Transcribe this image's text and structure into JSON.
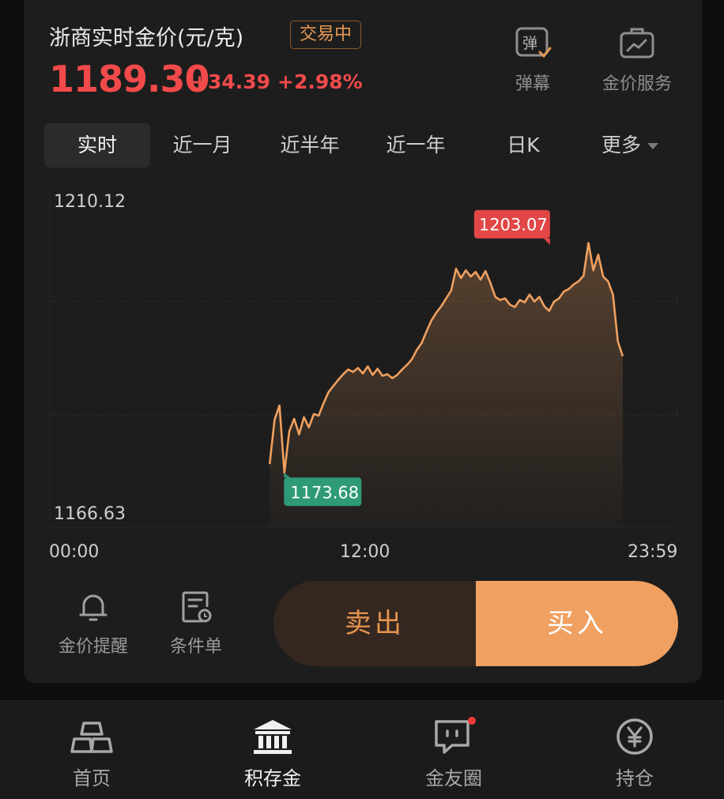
{
  "header": {
    "title": "浙商实时金价(元/克)",
    "status_badge": "交易中",
    "price": "1189.30",
    "change_abs": "+34.39",
    "change_pct": "+2.98%",
    "price_color": "#f24a4a",
    "actions": [
      {
        "label": "弹幕",
        "icon": "danmaku-icon"
      },
      {
        "label": "金价服务",
        "icon": "briefcase-chart-icon"
      }
    ]
  },
  "tabs": [
    {
      "label": "实时",
      "active": true
    },
    {
      "label": "近一月",
      "active": false
    },
    {
      "label": "近半年",
      "active": false
    },
    {
      "label": "近一年",
      "active": false
    },
    {
      "label": "日K",
      "active": false
    },
    {
      "label": "更多",
      "active": false
    }
  ],
  "chart_data": {
    "type": "area",
    "y_axis": {
      "max_label": "1210.12",
      "min_label": "1166.63",
      "ylim": [
        1166.63,
        1210.12
      ]
    },
    "x_axis": {
      "labels": [
        "00:00",
        "12:00",
        "23:59"
      ],
      "xlim": [
        0,
        1439
      ]
    },
    "grid": true,
    "line_color": "#f0a060",
    "high": {
      "label": "1203.07",
      "value": 1203.07,
      "time": 1226
    },
    "low": {
      "label": "1173.68",
      "value": 1173.68,
      "time": 575
    },
    "points": [
      [
        540,
        1174.8
      ],
      [
        552,
        1180.5
      ],
      [
        564,
        1182.3
      ],
      [
        576,
        1173.7
      ],
      [
        588,
        1179.0
      ],
      [
        600,
        1180.6
      ],
      [
        612,
        1178.6
      ],
      [
        624,
        1180.8
      ],
      [
        636,
        1179.5
      ],
      [
        648,
        1181.2
      ],
      [
        660,
        1181.0
      ],
      [
        672,
        1182.6
      ],
      [
        684,
        1184.0
      ],
      [
        696,
        1184.8
      ],
      [
        708,
        1185.6
      ],
      [
        720,
        1186.3
      ],
      [
        732,
        1186.9
      ],
      [
        744,
        1186.6
      ],
      [
        756,
        1187.1
      ],
      [
        768,
        1186.4
      ],
      [
        780,
        1187.3
      ],
      [
        792,
        1186.2
      ],
      [
        804,
        1187.0
      ],
      [
        816,
        1186.1
      ],
      [
        828,
        1186.3
      ],
      [
        840,
        1185.8
      ],
      [
        852,
        1186.2
      ],
      [
        864,
        1186.9
      ],
      [
        876,
        1187.5
      ],
      [
        888,
        1188.2
      ],
      [
        900,
        1189.4
      ],
      [
        912,
        1190.3
      ],
      [
        924,
        1191.8
      ],
      [
        936,
        1193.2
      ],
      [
        948,
        1194.2
      ],
      [
        960,
        1195.0
      ],
      [
        972,
        1196.0
      ],
      [
        984,
        1197.0
      ],
      [
        996,
        1199.8
      ],
      [
        1008,
        1198.6
      ],
      [
        1020,
        1199.6
      ],
      [
        1032,
        1198.8
      ],
      [
        1044,
        1199.4
      ],
      [
        1056,
        1198.4
      ],
      [
        1068,
        1199.5
      ],
      [
        1080,
        1198.0
      ],
      [
        1092,
        1196.2
      ],
      [
        1104,
        1195.8
      ],
      [
        1116,
        1196.0
      ],
      [
        1128,
        1195.2
      ],
      [
        1140,
        1194.9
      ],
      [
        1152,
        1195.8
      ],
      [
        1164,
        1195.5
      ],
      [
        1176,
        1196.5
      ],
      [
        1188,
        1195.6
      ],
      [
        1200,
        1196.2
      ],
      [
        1212,
        1195.0
      ],
      [
        1224,
        1194.4
      ],
      [
        1236,
        1195.6
      ],
      [
        1248,
        1196.0
      ],
      [
        1260,
        1196.9
      ],
      [
        1272,
        1197.2
      ],
      [
        1284,
        1197.8
      ],
      [
        1296,
        1198.2
      ],
      [
        1308,
        1198.9
      ],
      [
        1320,
        1203.1
      ],
      [
        1332,
        1199.6
      ],
      [
        1344,
        1201.6
      ],
      [
        1356,
        1198.8
      ],
      [
        1368,
        1198.2
      ],
      [
        1380,
        1196.5
      ],
      [
        1392,
        1190.5
      ],
      [
        1404,
        1188.6
      ]
    ]
  },
  "tools": [
    {
      "label": "金价提醒",
      "icon": "bell-icon"
    },
    {
      "label": "条件单",
      "icon": "conditional-order-icon"
    }
  ],
  "trade": {
    "sell_label": "卖出",
    "buy_label": "买入"
  },
  "bottom_nav": [
    {
      "label": "首页",
      "icon": "gold-bars-icon",
      "active": false
    },
    {
      "label": "积存金",
      "icon": "bank-icon",
      "active": true
    },
    {
      "label": "金友圈",
      "icon": "chat-bubble-icon",
      "active": false,
      "badge": true
    },
    {
      "label": "持仓",
      "icon": "yen-circle-icon",
      "active": false
    }
  ]
}
